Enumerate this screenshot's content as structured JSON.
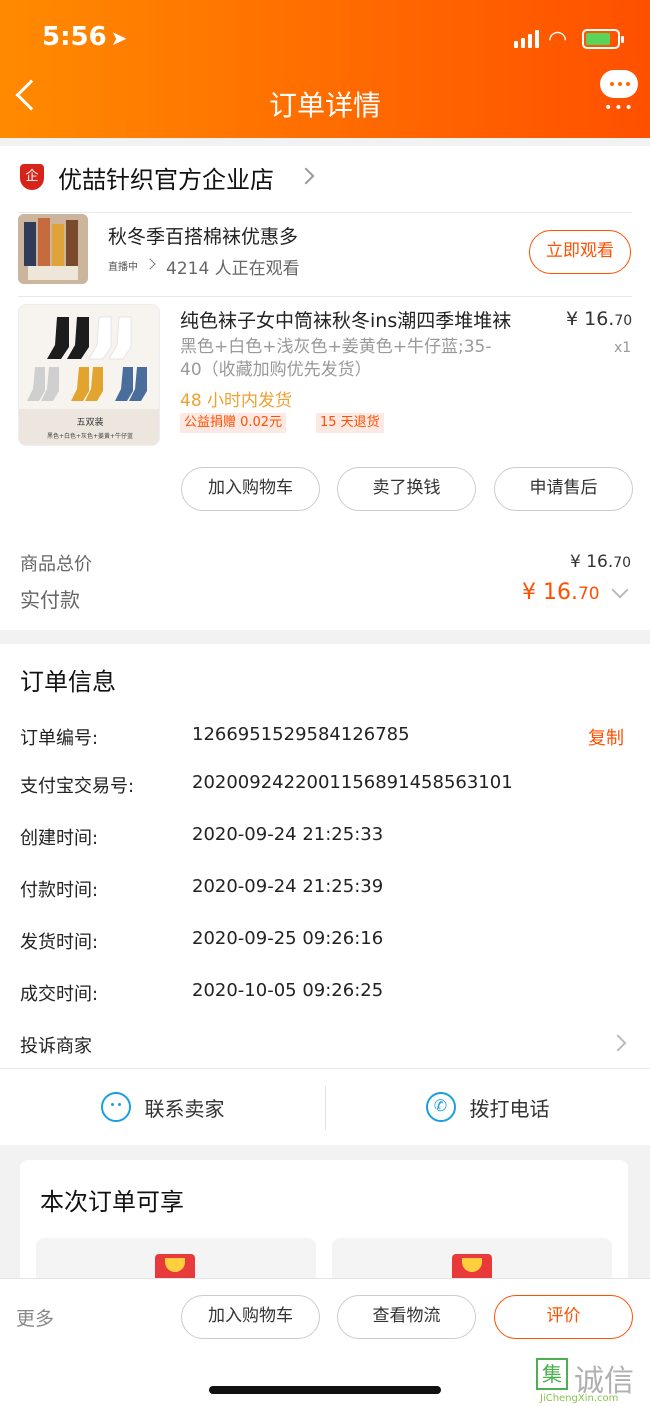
{
  "status_bar": {
    "time": "5:56"
  },
  "nav": {
    "title": "订单详情"
  },
  "shop": {
    "badge": "企",
    "name": "优喆针织官方企业店"
  },
  "live": {
    "title": "秋冬季百搭棉袜优惠多",
    "badge": "直播中",
    "viewers": "4214 人正在观看",
    "watch_label": "立即观看"
  },
  "product": {
    "name": "纯色袜子女中筒袜秋冬ins潮四季堆堆袜",
    "price_main": "¥ 16.",
    "price_dec": "70",
    "qty": "x1",
    "spec": "黑色+白色+浅灰色+姜黄色+牛仔蓝;35-40（收藏加购优先发货）",
    "ship_note": "48 小时内发货",
    "tags": [
      "公益捐赠 0.02元",
      "15 天退货"
    ],
    "image_caption": "五双装",
    "image_sub": "黑色+白色+灰色+姜黄+牛仔蓝"
  },
  "product_actions": [
    "加入购物车",
    "卖了换钱",
    "申请售后"
  ],
  "summary": {
    "total_label": "商品总价",
    "total_main": "¥ 16.",
    "total_dec": "70",
    "paid_label": "实付款",
    "paid_main": "¥ 16.",
    "paid_dec": "70"
  },
  "order_info": {
    "title": "订单信息",
    "copy_label": "复制",
    "rows": [
      {
        "label": "订单编号:",
        "value": "1266951529584126785"
      },
      {
        "label": "支付宝交易号:",
        "value": "2020092422001156891458563101"
      },
      {
        "label": "创建时间:",
        "value": "2020-09-24 21:25:33"
      },
      {
        "label": "付款时间:",
        "value": "2020-09-24 21:25:39"
      },
      {
        "label": "发货时间:",
        "value": "2020-09-25 09:26:16"
      },
      {
        "label": "成交时间:",
        "value": "2020-10-05 09:26:25"
      }
    ],
    "complain_label": "投诉商家"
  },
  "contact": {
    "chat_label": "联系卖家",
    "call_label": "拨打电话"
  },
  "benefits": {
    "title": "本次订单可享"
  },
  "bottom_bar": {
    "more": "更多",
    "buttons": [
      "加入购物车",
      "查看物流",
      "评价"
    ]
  },
  "watermark": {
    "glyph": "集",
    "text": "诚信",
    "sub": "JiChengXin.com"
  },
  "colors": {
    "accent": "#ff5000",
    "header_start": "#ff8a00",
    "link_blue": "#1a9fe0",
    "ship_note": "#f0a030"
  }
}
